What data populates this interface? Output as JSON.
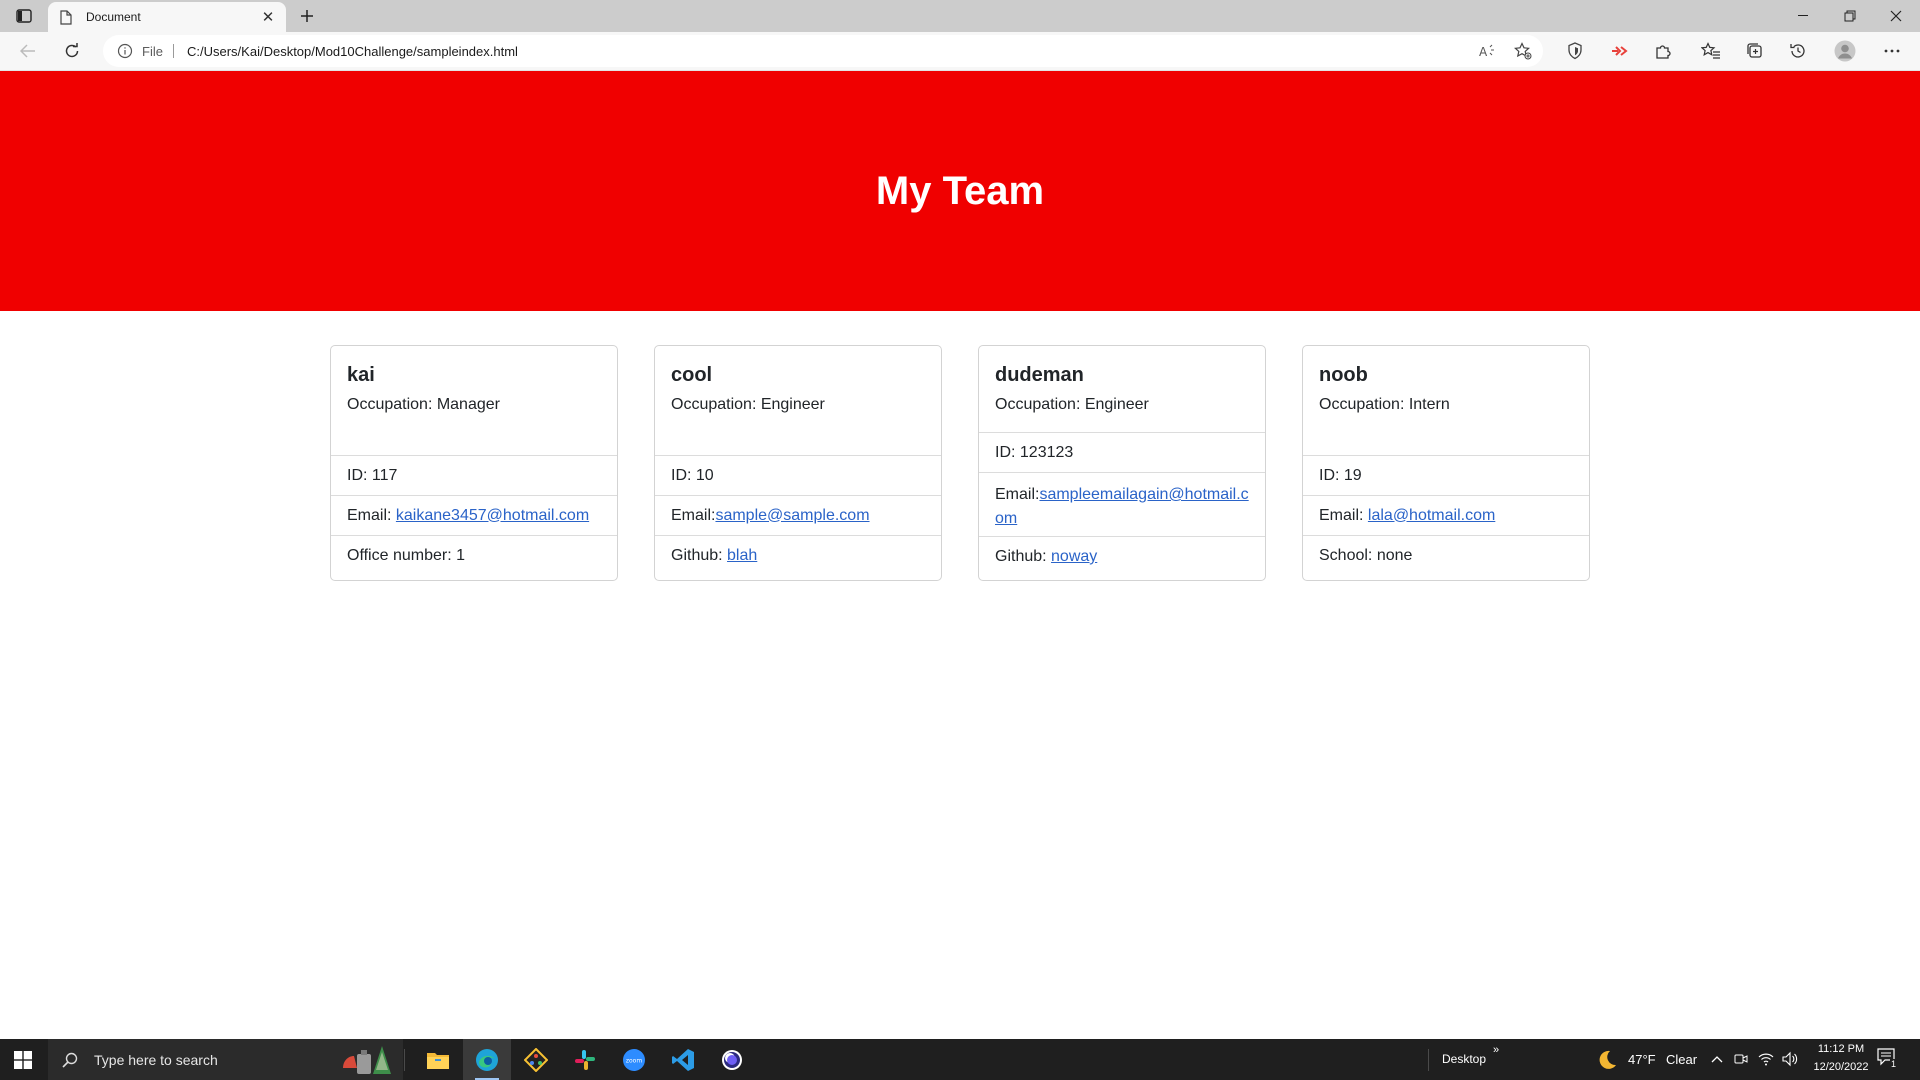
{
  "browser": {
    "tab_title": "Document",
    "address_scheme_label": "File",
    "url": "C:/Users/Kai/Desktop/Mod10Challenge/sampleindex.html"
  },
  "page": {
    "heading": "My Team",
    "header_color": "#f00000",
    "link_color": "#2a63c8"
  },
  "cards": [
    {
      "name": "kai",
      "occupation": "Occupation: Manager",
      "id": "ID: 117",
      "email_label": "Email: ",
      "email": "kaikane3457@hotmail.com",
      "extra": "Office number: 1"
    },
    {
      "name": "cool",
      "occupation": "Occupation: Engineer",
      "id": "ID: 10",
      "email_label": "Email:",
      "email": "sample@sample.com",
      "extra_label": "Github: ",
      "extra_link": "blah"
    },
    {
      "name": "dudeman",
      "occupation": "Occupation: Engineer",
      "id": "ID: 123123",
      "email_label": "Email:",
      "email": "sampleemailagain@hotmail.com",
      "extra_label": "Github: ",
      "extra_link": "noway"
    },
    {
      "name": "noob",
      "occupation": "Occupation: Intern",
      "id": "ID: 19",
      "email_label": "Email: ",
      "email": "lala@hotmail.com",
      "extra": "School: none"
    }
  ],
  "taskbar": {
    "search_placeholder": "Type here to search",
    "desktop_label": "Desktop",
    "weather_temp": "47°F",
    "weather_cond": "Clear",
    "time": "11:12 PM",
    "date": "12/20/2022",
    "notification_count": "1",
    "apps": [
      "file-explorer-icon",
      "edge-icon",
      "git-icon",
      "slack-icon",
      "zoom-icon",
      "vscode-icon",
      "browser-app-icon"
    ]
  }
}
